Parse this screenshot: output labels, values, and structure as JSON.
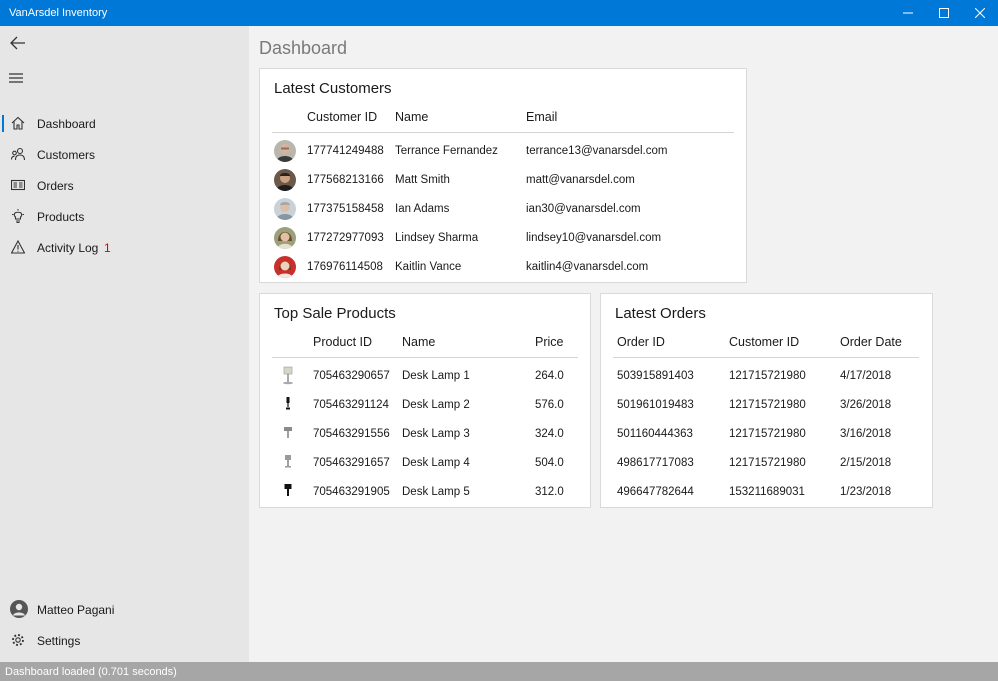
{
  "window": {
    "title": "VanArsdel Inventory",
    "minimize": "—",
    "maximize": "☐",
    "close": "✕"
  },
  "sidebar": {
    "items": [
      {
        "label": "Dashboard",
        "icon": "home-icon",
        "active": true
      },
      {
        "label": "Customers",
        "icon": "people-icon"
      },
      {
        "label": "Orders",
        "icon": "orders-icon"
      },
      {
        "label": "Products",
        "icon": "lightbulb-icon"
      },
      {
        "label": "Activity Log",
        "icon": "warning-icon",
        "badge": "1"
      }
    ],
    "user": "Matteo Pagani",
    "settings": "Settings"
  },
  "page": {
    "title": "Dashboard"
  },
  "customers": {
    "title": "Latest Customers",
    "headers": [
      "Customer ID",
      "Name",
      "Email"
    ],
    "rows": [
      {
        "id": "177741249488",
        "name": "Terrance Fernandez",
        "email": "terrance13@vanarsdel.com"
      },
      {
        "id": "177568213166",
        "name": "Matt Smith",
        "email": "matt@vanarsdel.com"
      },
      {
        "id": "177375158458",
        "name": "Ian Adams",
        "email": "ian30@vanarsdel.com"
      },
      {
        "id": "177272977093",
        "name": "Lindsey Sharma",
        "email": "lindsey10@vanarsdel.com"
      },
      {
        "id": "176976114508",
        "name": "Kaitlin Vance",
        "email": "kaitlin4@vanarsdel.com"
      }
    ]
  },
  "products": {
    "title": "Top Sale Products",
    "headers": [
      "Product ID",
      "Name",
      "Price"
    ],
    "rows": [
      {
        "id": "705463290657",
        "name": "Desk Lamp 1",
        "price": "264.0"
      },
      {
        "id": "705463291124",
        "name": "Desk Lamp 2",
        "price": "576.0"
      },
      {
        "id": "705463291556",
        "name": "Desk Lamp 3",
        "price": "324.0"
      },
      {
        "id": "705463291657",
        "name": "Desk Lamp 4",
        "price": "504.0"
      },
      {
        "id": "705463291905",
        "name": "Desk Lamp 5",
        "price": "312.0"
      }
    ]
  },
  "orders": {
    "title": "Latest Orders",
    "headers": [
      "Order ID",
      "Customer ID",
      "Order Date"
    ],
    "rows": [
      {
        "id": "503915891403",
        "customer": "121715721980",
        "date": "4/17/2018"
      },
      {
        "id": "501961019483",
        "customer": "121715721980",
        "date": "3/26/2018"
      },
      {
        "id": "501160444363",
        "customer": "121715721980",
        "date": "3/16/2018"
      },
      {
        "id": "498617717083",
        "customer": "121715721980",
        "date": "2/15/2018"
      },
      {
        "id": "496647782644",
        "customer": "153211689031",
        "date": "1/23/2018"
      }
    ]
  },
  "status": {
    "text": "Dashboard loaded (0.701 seconds)"
  },
  "colors": {
    "accent": "#0078d7",
    "badge": "#dd0000",
    "sidebar": "#e6e6e6",
    "statusbar": "#a6a6a6"
  }
}
